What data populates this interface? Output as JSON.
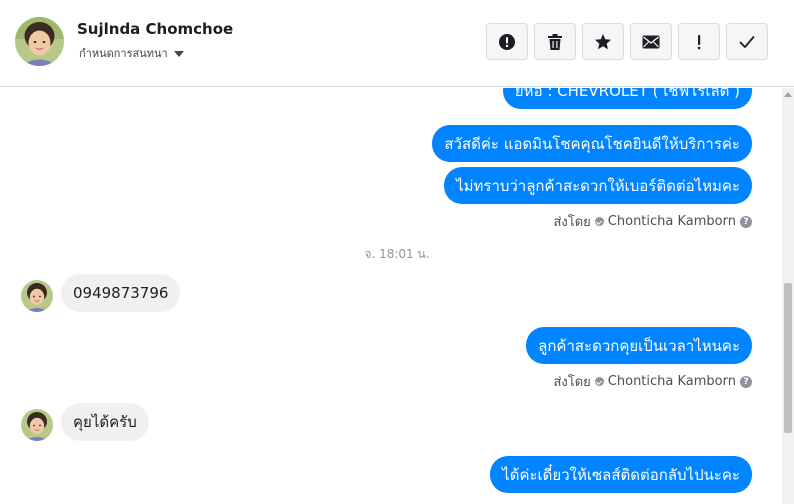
{
  "header": {
    "contact_name": "Sujlnda Chomchoe",
    "assign_label": "กำหนดการสนทนา",
    "toolbar": [
      {
        "name": "spam-button",
        "icon": "alert-circle-icon"
      },
      {
        "name": "delete-button",
        "icon": "trash-icon"
      },
      {
        "name": "star-button",
        "icon": "star-icon"
      },
      {
        "name": "mark-unread-button",
        "icon": "envelope-icon"
      },
      {
        "name": "follow-up-button",
        "icon": "exclamation-icon"
      },
      {
        "name": "mark-done-button",
        "icon": "checkmark-icon"
      }
    ]
  },
  "conversation": {
    "messages": [
      {
        "type": "outgoing",
        "text": "ยี่ห้อ : CHEVROLET ( เชฟโรเลต )"
      },
      {
        "type": "outgoing",
        "text": "สวัสดีค่ะ แอดมินโชคคุณโชคยินดีให้บริการค่ะ"
      },
      {
        "type": "outgoing",
        "text": "ไม่ทราบว่าลูกค้าสะดวกให้เบอร์ติดต่อไหมคะ"
      },
      {
        "type": "sent_by",
        "prefix": "ส่งโดย",
        "agent": "Chonticha Kamborn"
      },
      {
        "type": "timestamp",
        "text": "จ. 18:01 น."
      },
      {
        "type": "incoming",
        "text": "0949873796"
      },
      {
        "type": "outgoing",
        "text": "ลูกค้าสะดวกคุยเป็นเวลาไหนคะ"
      },
      {
        "type": "sent_by",
        "prefix": "ส่งโดย",
        "agent": "Chonticha Kamborn"
      },
      {
        "type": "incoming",
        "text": "คุยได้ครับ"
      },
      {
        "type": "outgoing",
        "text": "ได้ค่ะเดี๋ยวให้เซลส์ติดต่อกลับไปนะคะ"
      }
    ]
  },
  "colors": {
    "outgoing_bubble": "#0084ff",
    "incoming_bubble": "#f0f0f0"
  }
}
